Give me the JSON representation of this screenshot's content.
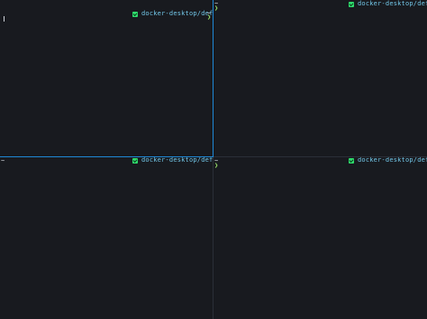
{
  "panes": {
    "top_left": {
      "context": "docker-desktop/default",
      "dir": "~",
      "prompt": "❯"
    },
    "top_right": {
      "context": "docker-desktop/default",
      "dir": "~",
      "prompt": "❯"
    },
    "bottom_left": {
      "context": "docker-desktop/default",
      "dir": "~"
    },
    "bottom_right": {
      "context": "docker-desktop/default",
      "dir": "~",
      "prompt": "❯"
    }
  },
  "colors": {
    "background": "#181a1f",
    "active_border": "#1e88d6",
    "context_text": "#72c7e8",
    "prompt": "#9ee86c",
    "kube_icon": "#2fdc6c"
  },
  "icons": {
    "context_icon": "kubernetes-context-icon"
  }
}
